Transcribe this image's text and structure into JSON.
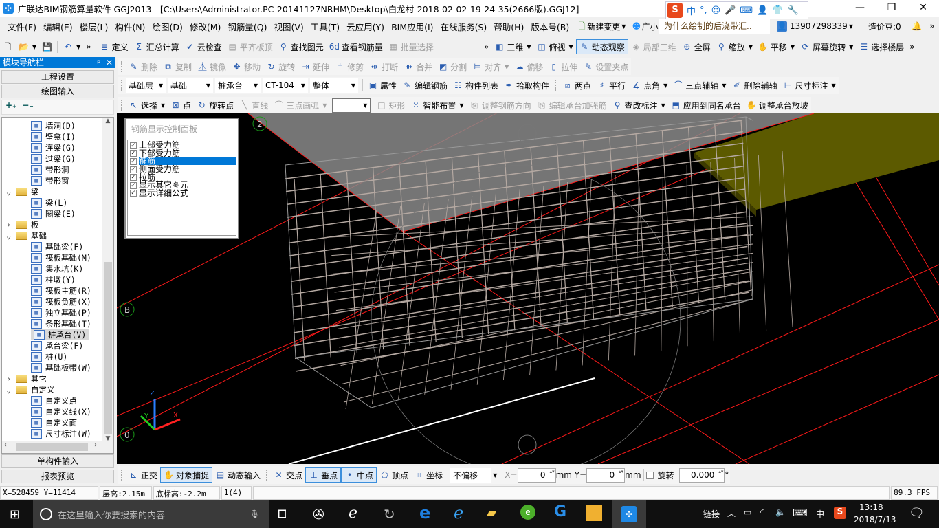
{
  "window": {
    "title": "广联达BIM钢筋算量软件 GGJ2013 - [C:\\Users\\Administrator.PC-20141127NRHM\\Desktop\\白龙村-2018-02-02-19-24-35(2666版).GGJ12]",
    "minimize": "—",
    "maximize": "❐",
    "close": "✕"
  },
  "ime": {
    "logo": "S",
    "items": [
      "中",
      "°,",
      "☺",
      "🎤",
      "⌨",
      "👤",
      "👕",
      "🔧"
    ]
  },
  "menu": {
    "items": [
      "文件(F)",
      "编辑(E)",
      "楼层(L)",
      "构件(N)",
      "绘图(D)",
      "修改(M)",
      "钢筋量(Q)",
      "视图(V)",
      "工具(T)",
      "云应用(Y)",
      "BIM应用(I)",
      "在线服务(S)",
      "帮助(H)",
      "版本号(B)"
    ],
    "new_change": "新建变更",
    "assistant": "广小二",
    "search_text": "为什么绘制的后浇带汇..",
    "user": "13907298339",
    "beans": "造价豆:0",
    "more": "»"
  },
  "toolbar1": {
    "left": [
      {
        "label": "定义",
        "icon": "≣"
      },
      {
        "label": "汇总计算",
        "icon": "Σ"
      },
      {
        "label": "云检查",
        "icon": "✔"
      },
      {
        "label": "平齐板顶",
        "icon": "▤",
        "disabled": true
      },
      {
        "label": "查找图元",
        "icon": "⚲"
      },
      {
        "label": "查看钢筋量",
        "icon": "6d"
      },
      {
        "label": "批量选择",
        "icon": "▦",
        "disabled": true
      }
    ],
    "right": [
      {
        "label": "三维",
        "icon": "◧",
        "dropdown": true
      },
      {
        "label": "俯视",
        "icon": "◫",
        "dropdown": true
      },
      {
        "label": "动态观察",
        "icon": "✎",
        "active": true
      },
      {
        "label": "局部三维",
        "icon": "◈",
        "disabled": true
      },
      {
        "label": "全屏",
        "icon": "⊕"
      },
      {
        "label": "缩放",
        "icon": "⚲",
        "dropdown": true
      },
      {
        "label": "平移",
        "icon": "✋",
        "dropdown": true
      },
      {
        "label": "屏幕旋转",
        "icon": "⟳",
        "dropdown": true
      },
      {
        "label": "选择楼层",
        "icon": "☰"
      }
    ]
  },
  "toolbar2": {
    "items": [
      {
        "label": "删除",
        "icon": "✎"
      },
      {
        "label": "复制",
        "icon": "⧉"
      },
      {
        "label": "镜像",
        "icon": "⏅"
      },
      {
        "label": "移动",
        "icon": "✥"
      },
      {
        "label": "旋转",
        "icon": "↻"
      },
      {
        "label": "延伸",
        "icon": "⇥"
      },
      {
        "label": "修剪",
        "icon": "⫩"
      },
      {
        "label": "打断",
        "icon": "⇹"
      },
      {
        "label": "合并",
        "icon": "⇻"
      },
      {
        "label": "分割",
        "icon": "◩"
      },
      {
        "label": "对齐",
        "icon": "⊨",
        "dropdown": true
      },
      {
        "label": "偏移",
        "icon": "☁"
      },
      {
        "label": "拉伸",
        "icon": "▯"
      },
      {
        "label": "设置夹点",
        "icon": "✎"
      }
    ]
  },
  "toolbar3": {
    "selects": [
      "基础层",
      "基础",
      "桩承台",
      "CT-104",
      "整体"
    ],
    "items": [
      {
        "label": "属性",
        "icon": "▣"
      },
      {
        "label": "编辑钢筋",
        "icon": "✎"
      },
      {
        "label": "构件列表",
        "icon": "☷"
      },
      {
        "label": "拾取构件",
        "icon": "✒"
      }
    ],
    "axis_items": [
      {
        "label": "两点",
        "icon": "⧄"
      },
      {
        "label": "平行",
        "icon": "♯"
      },
      {
        "label": "点角",
        "icon": "∡",
        "dropdown": true
      },
      {
        "label": "三点辅轴",
        "icon": "⌒",
        "dropdown": true
      },
      {
        "label": "删除辅轴",
        "icon": "✐"
      },
      {
        "label": "尺寸标注",
        "icon": "⊢",
        "dropdown": true
      }
    ]
  },
  "toolbar4": {
    "items": [
      {
        "label": "选择",
        "icon": "↖",
        "dropdown": true
      },
      {
        "label": "点",
        "icon": "⊠"
      },
      {
        "label": "旋转点",
        "icon": "↻"
      },
      {
        "label": "直线",
        "icon": "╲",
        "disabled": true
      },
      {
        "label": "三点画弧",
        "icon": "⌒",
        "disabled": true,
        "dropdown": true
      }
    ],
    "combo": "",
    "items2": [
      {
        "label": "矩形",
        "icon": "□",
        "disabled": true
      },
      {
        "label": "智能布置",
        "icon": "⁙",
        "dropdown": true
      },
      {
        "label": "调整钢筋方向",
        "icon": "⎘",
        "disabled": true
      },
      {
        "label": "编辑承台加强筋",
        "icon": "⎘",
        "disabled": true
      },
      {
        "label": "查改标注",
        "icon": "⚲",
        "dropdown": true
      },
      {
        "label": "应用到同名承台",
        "icon": "⬒"
      },
      {
        "label": "调整承台放坡",
        "icon": "✋"
      }
    ]
  },
  "nav": {
    "title": "模块导航栏",
    "pin": "ᵖ",
    "close": "✕",
    "project_settings": "工程设置",
    "drawing_input": "绘图输入",
    "expand": "+₊",
    "collapse": "−₋",
    "single_input": "单构件输入",
    "report_preview": "报表预览",
    "tree": [
      {
        "label": "墙洞(D)",
        "level": 2
      },
      {
        "label": "壁龛(I)",
        "level": 2
      },
      {
        "label": "连梁(G)",
        "level": 2
      },
      {
        "label": "过梁(G)",
        "level": 2
      },
      {
        "label": "带形洞",
        "level": 2
      },
      {
        "label": "带形窗",
        "level": 2
      },
      {
        "label": "梁",
        "level": 1,
        "folder": "open"
      },
      {
        "label": "梁(L)",
        "level": 2
      },
      {
        "label": "圈梁(E)",
        "level": 2
      },
      {
        "label": "板",
        "level": 1,
        "folder": "closed"
      },
      {
        "label": "基础",
        "level": 1,
        "folder": "open"
      },
      {
        "label": "基础梁(F)",
        "level": 2
      },
      {
        "label": "筏板基础(M)",
        "level": 2
      },
      {
        "label": "集水坑(K)",
        "level": 2
      },
      {
        "label": "柱墩(Y)",
        "level": 2
      },
      {
        "label": "筏板主筋(R)",
        "level": 2
      },
      {
        "label": "筏板负筋(X)",
        "level": 2
      },
      {
        "label": "独立基础(P)",
        "level": 2
      },
      {
        "label": "条形基础(T)",
        "level": 2
      },
      {
        "label": "桩承台(V)",
        "level": 2,
        "selected": true
      },
      {
        "label": "承台梁(F)",
        "level": 2
      },
      {
        "label": "桩(U)",
        "level": 2
      },
      {
        "label": "基础板带(W)",
        "level": 2
      },
      {
        "label": "其它",
        "level": 1,
        "folder": "closed"
      },
      {
        "label": "自定义",
        "level": 1,
        "folder": "open"
      },
      {
        "label": "自定义点",
        "level": 2
      },
      {
        "label": "自定义线(X)",
        "level": 2
      },
      {
        "label": "自定义面",
        "level": 2
      },
      {
        "label": "尺寸标注(W)",
        "level": 2
      }
    ]
  },
  "rebar_panel": {
    "title": "钢筋显示控制面板",
    "items": [
      {
        "label": "上部受力筋",
        "checked": true
      },
      {
        "label": "下部受力筋",
        "checked": true
      },
      {
        "label": "箍筋",
        "checked": true,
        "highlighted": true
      },
      {
        "label": "侧面受力筋",
        "checked": true
      },
      {
        "label": "拉筋",
        "checked": true
      },
      {
        "label": "显示其它图元",
        "checked": true
      },
      {
        "label": "显示详细公式",
        "checked": true
      }
    ]
  },
  "viewport": {
    "axis_labels": [
      "B",
      "0",
      "2"
    ],
    "gizmo": {
      "x": "X",
      "y": "Y",
      "z": "Z"
    },
    "colors": {
      "background": "#000000",
      "rebar": "#b5a9a2",
      "axis_line": "#ff1a1a",
      "slab": "#8a8a8a",
      "beam": "#5c5a00"
    }
  },
  "snapbar": {
    "items": [
      {
        "label": "正交",
        "icon": "⊾"
      },
      {
        "label": "对象捕捉",
        "icon": "✋",
        "active": true
      },
      {
        "label": "动态输入",
        "icon": "▤"
      }
    ],
    "snaps": [
      {
        "label": "交点",
        "icon": "✕"
      },
      {
        "label": "垂点",
        "icon": "⊥",
        "active": true
      },
      {
        "label": "中点",
        "icon": "•",
        "active": true
      },
      {
        "label": "顶点",
        "icon": "⬠"
      },
      {
        "label": "坐标",
        "icon": "⌗"
      }
    ],
    "offset": "不偏移",
    "x_label": "X=",
    "x_value": "0",
    "y_label": "Y=",
    "y_value": "0",
    "unit": "mm",
    "rotate_label": "旋转",
    "rotate_value": "0.000",
    "degree": "°"
  },
  "status": {
    "coords": "X=528459 Y=11414",
    "floor_height": "层高:2.15m",
    "bottom_elev": "底标高:-2.2m",
    "count": "1(4)",
    "fps": "89.3 FPS"
  },
  "taskbar": {
    "search_placeholder": "在这里输入你要搜索的内容",
    "links": "链接",
    "ime": "中",
    "time": "13:18",
    "date": "2018/7/13"
  }
}
